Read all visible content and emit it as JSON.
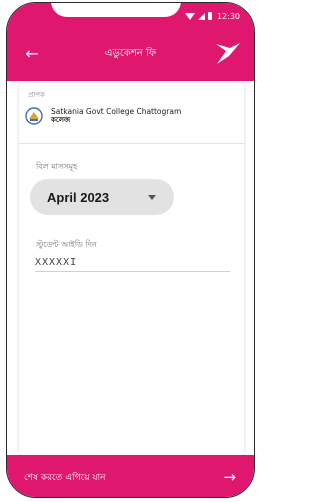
{
  "status_bar": {
    "time": "12:30"
  },
  "app_bar": {
    "title": "এডুকেশন ফি",
    "back_icon": "←"
  },
  "institution": {
    "label": "প্রাপক",
    "name": "Satkania Govt College Chattogram",
    "subname": "কলেজ"
  },
  "billing_month": {
    "label": "বিল মাসসমূহ",
    "selected": "April 2023"
  },
  "student_id": {
    "label": "স্টুডেন্ট আইডি দিন",
    "value": "XXXXXI"
  },
  "bottom": {
    "label": "শেষ করতে এগিয়ে যান",
    "arrow": "→"
  },
  "colors": {
    "accent": "#e0176f",
    "select_bg": "#e2e2e2"
  }
}
